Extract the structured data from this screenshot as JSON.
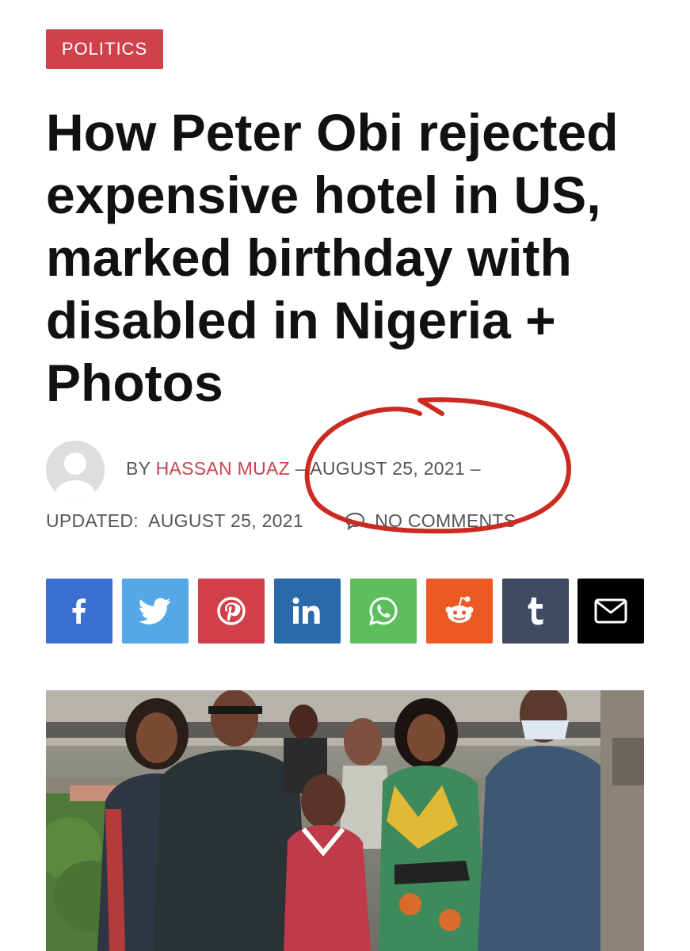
{
  "article": {
    "category": "POLITICS",
    "headline": "How Peter Obi rejected expensive hotel in US, marked birthday with disabled in Nigeria + Photos"
  },
  "meta": {
    "by_label": "BY",
    "author": "HASSAN MUAZ",
    "separator": "–",
    "published_date": "AUGUST 25, 2021",
    "trailing_separator": "–",
    "updated_label": "UPDATED:",
    "updated_date": "AUGUST 25, 2021",
    "comments_label": "NO COMMENTS"
  },
  "share_buttons": [
    {
      "network": "facebook",
      "icon": "facebook-icon",
      "color": "#3b6fd1"
    },
    {
      "network": "twitter",
      "icon": "twitter-icon",
      "color": "#54a8e6"
    },
    {
      "network": "pinterest",
      "icon": "pinterest-icon",
      "color": "#d1404a"
    },
    {
      "network": "linkedin",
      "icon": "linkedin-icon",
      "color": "#2a6aa8"
    },
    {
      "network": "whatsapp",
      "icon": "whatsapp-icon",
      "color": "#5cbf5c"
    },
    {
      "network": "reddit",
      "icon": "reddit-icon",
      "color": "#ec5a24"
    },
    {
      "network": "tumblr",
      "icon": "tumblr-icon",
      "color": "#3d4a5f"
    },
    {
      "network": "email",
      "icon": "envelope-icon",
      "color": "#000000"
    }
  ],
  "colors": {
    "accent": "#d0414c",
    "annotation_circle": "#cc2a20",
    "meta_text": "#555555"
  }
}
